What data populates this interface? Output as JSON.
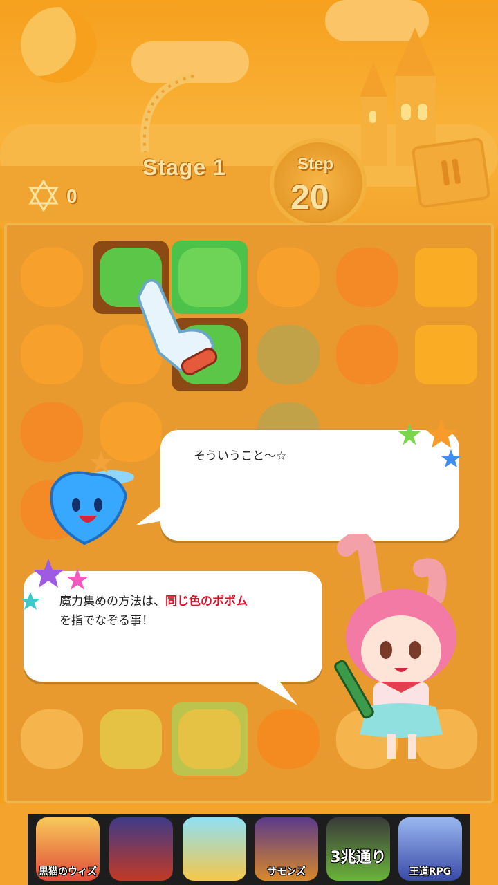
{
  "hud": {
    "stage_label": "Stage 1",
    "step_label": "Step",
    "steps_left": "20",
    "score": "0"
  },
  "tutorial": {
    "mascot_line": "そういうこと～☆",
    "guide_line_1_pre": "魔力集めの方法は、",
    "guide_line_1_highlight": "同じ色のポポム",
    "guide_line_2": "を指でなぞる事！"
  },
  "ads": [
    {
      "label": "黒猫のウィズ"
    },
    {
      "label": ""
    },
    {
      "label": ""
    },
    {
      "label": "サモンズ"
    },
    {
      "label": "3兆通り"
    },
    {
      "label": "王道RPG"
    }
  ],
  "colors": {
    "accent": "#e0122a",
    "board": "#e89a2e",
    "highlight_green": "#4cc24a"
  },
  "icons": [
    "star-of-david-icon",
    "pause-icon",
    "pointing-hand-icon",
    "star-icon"
  ]
}
